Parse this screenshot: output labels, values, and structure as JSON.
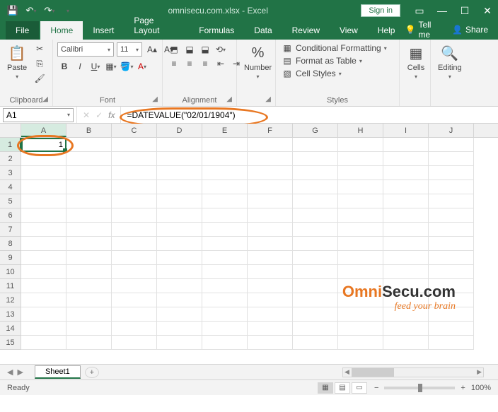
{
  "titlebar": {
    "docTitle": "omnisecu.com.xlsx - Excel",
    "signIn": "Sign in"
  },
  "tabs": {
    "file": "File",
    "home": "Home",
    "insert": "Insert",
    "pageLayout": "Page Layout",
    "formulas": "Formulas",
    "data": "Data",
    "review": "Review",
    "view": "View",
    "help": "Help",
    "tellMe": "Tell me",
    "share": "Share"
  },
  "ribbon": {
    "clipboard": {
      "label": "Clipboard",
      "paste": "Paste"
    },
    "font": {
      "label": "Font",
      "name": "Calibri",
      "size": "11"
    },
    "alignment": {
      "label": "Alignment"
    },
    "number": {
      "label": "Number",
      "btn": "Number"
    },
    "styles": {
      "label": "Styles",
      "cond": "Conditional Formatting",
      "table": "Format as Table",
      "cell": "Cell Styles"
    },
    "cells": {
      "label": "Cells",
      "btn": "Cells"
    },
    "editing": {
      "label": "Editing",
      "btn": "Editing"
    }
  },
  "formulaBar": {
    "nameBox": "A1",
    "fx": "fx",
    "formula": "=DATEVALUE(\"02/01/1904\")"
  },
  "grid": {
    "columns": [
      "A",
      "B",
      "C",
      "D",
      "E",
      "F",
      "G",
      "H",
      "I",
      "J"
    ],
    "rows": [
      "1",
      "2",
      "3",
      "4",
      "5",
      "6",
      "7",
      "8",
      "9",
      "10",
      "11",
      "12",
      "13",
      "14",
      "15"
    ],
    "cellA1": "1"
  },
  "watermark": {
    "line1a": "Omni",
    "line1b": "Secu.com",
    "line2": "feed your brain"
  },
  "sheets": {
    "sheet1": "Sheet1"
  },
  "statusBar": {
    "ready": "Ready",
    "zoom": "100%"
  }
}
